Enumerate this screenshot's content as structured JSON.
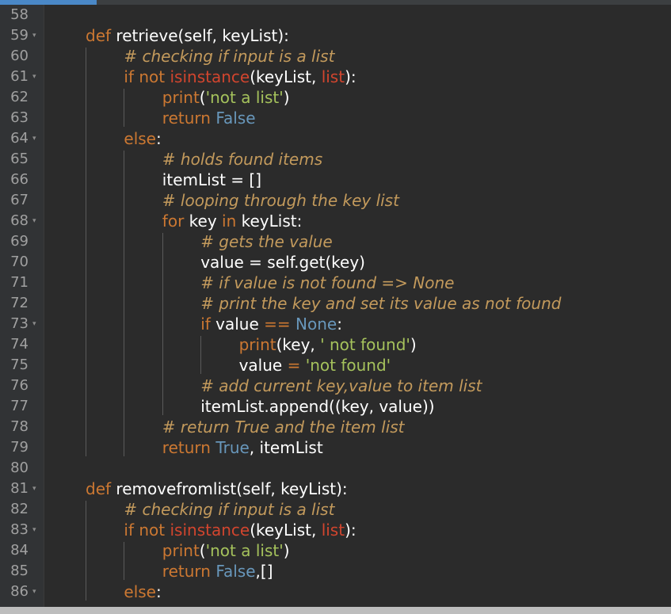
{
  "colors": {
    "background": "#2b2b2b",
    "gutter": "#313335",
    "keyword": "#cc7832",
    "builtin": "#d2452e",
    "constant": "#6897bb",
    "string": "#a5c25c",
    "comment": "#c39a5c",
    "accent": "#4a88c7"
  },
  "lines": [
    {
      "n": "58",
      "fold": false,
      "indent": 0,
      "tokens": []
    },
    {
      "n": "59",
      "fold": true,
      "indent": 0,
      "tokens": [
        {
          "t": "kw",
          "v": "def"
        },
        {
          "t": "plain",
          "v": " retrieve(self, keyList):"
        }
      ]
    },
    {
      "n": "60",
      "fold": false,
      "indent": 1,
      "tokens": [
        {
          "t": "cmt",
          "v": "# checking if input is a list"
        }
      ]
    },
    {
      "n": "61",
      "fold": true,
      "indent": 1,
      "tokens": [
        {
          "t": "kw",
          "v": "if"
        },
        {
          "t": "plain",
          "v": " "
        },
        {
          "t": "kw",
          "v": "not"
        },
        {
          "t": "plain",
          "v": " "
        },
        {
          "t": "builtin",
          "v": "isinstance"
        },
        {
          "t": "plain",
          "v": "(keyList, "
        },
        {
          "t": "builtin",
          "v": "list"
        },
        {
          "t": "plain",
          "v": "):"
        }
      ]
    },
    {
      "n": "62",
      "fold": false,
      "indent": 2,
      "tokens": [
        {
          "t": "kw",
          "v": "print"
        },
        {
          "t": "plain",
          "v": "("
        },
        {
          "t": "str",
          "v": "'not a list'"
        },
        {
          "t": "plain",
          "v": ")"
        }
      ]
    },
    {
      "n": "63",
      "fold": false,
      "indent": 2,
      "tokens": [
        {
          "t": "kw",
          "v": "return"
        },
        {
          "t": "plain",
          "v": " "
        },
        {
          "t": "const",
          "v": "False"
        }
      ]
    },
    {
      "n": "64",
      "fold": true,
      "indent": 1,
      "tokens": [
        {
          "t": "kw",
          "v": "else"
        },
        {
          "t": "plain",
          "v": ":"
        }
      ]
    },
    {
      "n": "65",
      "fold": false,
      "indent": 2,
      "tokens": [
        {
          "t": "cmt",
          "v": "# holds found items"
        }
      ]
    },
    {
      "n": "66",
      "fold": false,
      "indent": 2,
      "tokens": [
        {
          "t": "plain",
          "v": "itemList = []"
        }
      ]
    },
    {
      "n": "67",
      "fold": false,
      "indent": 2,
      "tokens": [
        {
          "t": "cmt",
          "v": "# looping through the key list"
        }
      ]
    },
    {
      "n": "68",
      "fold": true,
      "indent": 2,
      "tokens": [
        {
          "t": "kw",
          "v": "for"
        },
        {
          "t": "plain",
          "v": " key "
        },
        {
          "t": "kw",
          "v": "in"
        },
        {
          "t": "plain",
          "v": " keyList:"
        }
      ]
    },
    {
      "n": "69",
      "fold": false,
      "indent": 3,
      "tokens": [
        {
          "t": "cmt",
          "v": "# gets the value"
        }
      ]
    },
    {
      "n": "70",
      "fold": false,
      "indent": 3,
      "tokens": [
        {
          "t": "plain",
          "v": "value = self.get(key)"
        }
      ]
    },
    {
      "n": "71",
      "fold": false,
      "indent": 3,
      "tokens": [
        {
          "t": "cmt",
          "v": "# if value is not found => None"
        }
      ]
    },
    {
      "n": "72",
      "fold": false,
      "indent": 3,
      "tokens": [
        {
          "t": "cmt",
          "v": "# print the key and set its value as not found"
        }
      ]
    },
    {
      "n": "73",
      "fold": true,
      "indent": 3,
      "tokens": [
        {
          "t": "kw",
          "v": "if"
        },
        {
          "t": "plain",
          "v": " value "
        },
        {
          "t": "kw",
          "v": "=="
        },
        {
          "t": "plain",
          "v": " "
        },
        {
          "t": "const",
          "v": "None"
        },
        {
          "t": "plain",
          "v": ":"
        }
      ]
    },
    {
      "n": "74",
      "fold": false,
      "indent": 4,
      "tokens": [
        {
          "t": "kw",
          "v": "print"
        },
        {
          "t": "plain",
          "v": "(key, "
        },
        {
          "t": "str",
          "v": "' not found'"
        },
        {
          "t": "plain",
          "v": ")"
        }
      ]
    },
    {
      "n": "75",
      "fold": false,
      "indent": 4,
      "tokens": [
        {
          "t": "plain",
          "v": "value "
        },
        {
          "t": "kw",
          "v": "="
        },
        {
          "t": "plain",
          "v": " "
        },
        {
          "t": "str",
          "v": "'not found'"
        }
      ]
    },
    {
      "n": "76",
      "fold": false,
      "indent": 3,
      "tokens": [
        {
          "t": "cmt",
          "v": "# add current key,value to item list"
        }
      ]
    },
    {
      "n": "77",
      "fold": false,
      "indent": 3,
      "tokens": [
        {
          "t": "plain",
          "v": "itemList.append((key, value))"
        }
      ]
    },
    {
      "n": "78",
      "fold": false,
      "indent": 2,
      "tokens": [
        {
          "t": "cmt",
          "v": "# return True and the item list"
        }
      ]
    },
    {
      "n": "79",
      "fold": false,
      "indent": 2,
      "tokens": [
        {
          "t": "kw",
          "v": "return"
        },
        {
          "t": "plain",
          "v": " "
        },
        {
          "t": "const",
          "v": "True"
        },
        {
          "t": "plain",
          "v": ", itemList"
        }
      ]
    },
    {
      "n": "80",
      "fold": false,
      "indent": 0,
      "tokens": []
    },
    {
      "n": "81",
      "fold": true,
      "indent": 0,
      "tokens": [
        {
          "t": "kw",
          "v": "def"
        },
        {
          "t": "plain",
          "v": " removefromlist(self, keyList):"
        }
      ]
    },
    {
      "n": "82",
      "fold": false,
      "indent": 1,
      "tokens": [
        {
          "t": "cmt",
          "v": "# checking if input is a list"
        }
      ]
    },
    {
      "n": "83",
      "fold": true,
      "indent": 1,
      "tokens": [
        {
          "t": "kw",
          "v": "if"
        },
        {
          "t": "plain",
          "v": " "
        },
        {
          "t": "kw",
          "v": "not"
        },
        {
          "t": "plain",
          "v": " "
        },
        {
          "t": "builtin",
          "v": "isinstance"
        },
        {
          "t": "plain",
          "v": "(keyList, "
        },
        {
          "t": "builtin",
          "v": "list"
        },
        {
          "t": "plain",
          "v": "):"
        }
      ]
    },
    {
      "n": "84",
      "fold": false,
      "indent": 2,
      "tokens": [
        {
          "t": "kw",
          "v": "print"
        },
        {
          "t": "plain",
          "v": "("
        },
        {
          "t": "str",
          "v": "'not a list'"
        },
        {
          "t": "plain",
          "v": ")"
        }
      ]
    },
    {
      "n": "85",
      "fold": false,
      "indent": 2,
      "tokens": [
        {
          "t": "kw",
          "v": "return"
        },
        {
          "t": "plain",
          "v": " "
        },
        {
          "t": "const",
          "v": "False"
        },
        {
          "t": "plain",
          "v": ",[]"
        }
      ]
    },
    {
      "n": "86",
      "fold": true,
      "indent": 1,
      "tokens": [
        {
          "t": "kw",
          "v": "else"
        },
        {
          "t": "plain",
          "v": ":"
        }
      ]
    }
  ]
}
